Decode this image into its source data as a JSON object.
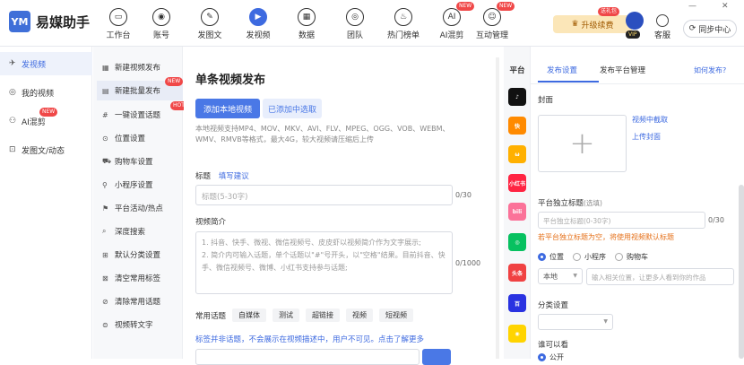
{
  "app": {
    "logo_mark": "YM",
    "name": "易媒助手"
  },
  "topnav": [
    {
      "label": "工作台",
      "icon": "monitor-icon",
      "glyph": "▭",
      "badge": ""
    },
    {
      "label": "账号",
      "icon": "user-icon",
      "glyph": "◉",
      "badge": ""
    },
    {
      "label": "发图文",
      "icon": "compose-icon",
      "glyph": "✎",
      "badge": ""
    },
    {
      "label": "发视频",
      "icon": "play-icon",
      "glyph": "▶",
      "badge": ""
    },
    {
      "label": "数据",
      "icon": "chart-icon",
      "glyph": "▦",
      "badge": ""
    },
    {
      "label": "团队",
      "icon": "team-icon",
      "glyph": "◎",
      "badge": ""
    },
    {
      "label": "热门榜单",
      "icon": "fire-icon",
      "glyph": "♨",
      "badge": ""
    },
    {
      "label": "AI混剪",
      "icon": "ai-icon",
      "glyph": "AI",
      "badge": "NEW"
    },
    {
      "label": "互动管理",
      "icon": "chat-icon",
      "glyph": "☺",
      "badge": "NEW"
    }
  ],
  "header_right": {
    "upgrade": "升级续费",
    "upgrade_tag": "送礼包",
    "vip": "VIP",
    "service": "客服",
    "sync": "同步中心",
    "minimize": "—",
    "close": "✕"
  },
  "leftnav": [
    {
      "label": "发视频",
      "icon": "send-icon",
      "glyph": "✈",
      "badge": ""
    },
    {
      "label": "我的视频",
      "icon": "video-icon",
      "glyph": "◎",
      "badge": ""
    },
    {
      "label": "AI混剪",
      "icon": "ai-icon",
      "glyph": "⚇",
      "badge": "NEW"
    },
    {
      "label": "发图文/动态",
      "icon": "doc-icon",
      "glyph": "⊡",
      "badge": ""
    }
  ],
  "subnav": [
    {
      "label": "新建视频发布",
      "icon": "grid-icon",
      "glyph": "▦",
      "badge": ""
    },
    {
      "label": "新建批量发布",
      "icon": "batch-icon",
      "glyph": "▤",
      "badge": "NEW"
    },
    {
      "label": "一键设置话题",
      "icon": "hash-icon",
      "glyph": "#",
      "badge": "HOT"
    },
    {
      "label": "位置设置",
      "icon": "location-icon",
      "glyph": "⊙",
      "badge": ""
    },
    {
      "label": "购物车设置",
      "icon": "cart-icon",
      "glyph": "⛟",
      "badge": ""
    },
    {
      "label": "小程序设置",
      "icon": "link-icon",
      "glyph": "⚲",
      "badge": ""
    },
    {
      "label": "平台活动/热点",
      "icon": "flag-icon",
      "glyph": "⚑",
      "badge": ""
    },
    {
      "label": "深度搜索",
      "icon": "search-icon",
      "glyph": "⌕",
      "badge": ""
    },
    {
      "label": "默认分类设置",
      "icon": "category-icon",
      "glyph": "⊞",
      "badge": ""
    },
    {
      "label": "清空常用标签",
      "icon": "clear-icon",
      "glyph": "⊠",
      "badge": ""
    },
    {
      "label": "清除常用话题",
      "icon": "erase-icon",
      "glyph": "⊘",
      "badge": ""
    },
    {
      "label": "视频转文字",
      "icon": "transcribe-icon",
      "glyph": "⊜",
      "badge": ""
    }
  ],
  "main": {
    "title": "单条视频发布",
    "add_local": "添加本地视频",
    "added": "已添加中选取",
    "formats": "本地视频支持MP4、MOV、MKV、AVI、FLV、MPEG、OGG、VOB、WEBM、WMV、RMVB等格式，最大4G，较大视频请压缩后上传",
    "title_label": "标题",
    "title_tip": "填写建议",
    "title_placeholder": "标题(5-30字)",
    "title_count": "0/30",
    "desc_label": "视频简介",
    "desc_line1": "1. 抖音、快手、微视、微信视频号、皮皮虾以视频简介作为文字展示;",
    "desc_line2": "2. 简介内可输入话题，单个话题以\"#\"号开头，以\"空格\"结果。目前抖音、快手、微信视频号、微博、小红书支持参与话题;",
    "desc_count": "0/1000",
    "common_topics_label": "常用话题",
    "topics": [
      "自媒体",
      "测试",
      "超链接",
      "视频",
      "短视频"
    ],
    "tag_note_prefix": "标签 ",
    "tag_note": "标签并非话题，不会展示在视频描述中，用户不可见。点击了解更多"
  },
  "platforms": {
    "header": "平台",
    "items": [
      {
        "name": "douyin",
        "short": "♪",
        "color": "#111111"
      },
      {
        "name": "kuaishou",
        "short": "快",
        "color": "#ff8a00"
      },
      {
        "name": "weishi",
        "short": "ω",
        "color": "#ffb000"
      },
      {
        "name": "xiaohongshu",
        "short": "小红书",
        "color": "#ff2442"
      },
      {
        "name": "bilibili",
        "short": "bili",
        "color": "#fb7299"
      },
      {
        "name": "wechat-channels",
        "short": "◎",
        "color": "#07c160"
      },
      {
        "name": "toutiao",
        "short": "头条",
        "color": "#f04142"
      },
      {
        "name": "baijiahao",
        "short": "百",
        "color": "#2932e1"
      },
      {
        "name": "pipixia",
        "short": "◉",
        "color": "#ffd400"
      }
    ]
  },
  "rpanel": {
    "tab_settings": "发布设置",
    "tab_manage": "发布平台管理",
    "help": "如何发布?",
    "cover_label": "封面",
    "cover_plus": "+",
    "cover_from_video": "视频中截取",
    "cover_upload": "上传封面",
    "indep_title_label": "平台独立标题",
    "indep_title_note": "(选填)",
    "indep_placeholder": "平台独立标题(0-30字)",
    "indep_count": "0/30",
    "warn": "若平台独立标题为空，将使用视频默认标题",
    "radio_location": "位置",
    "radio_miniapp": "小程序",
    "radio_cart": "购物车",
    "local_select": "本地",
    "location_placeholder": "输入相关位置，让更多人看到你的作品",
    "category_label": "分类设置",
    "visibility_label": "谁可以看",
    "visibility_public": "公开"
  }
}
